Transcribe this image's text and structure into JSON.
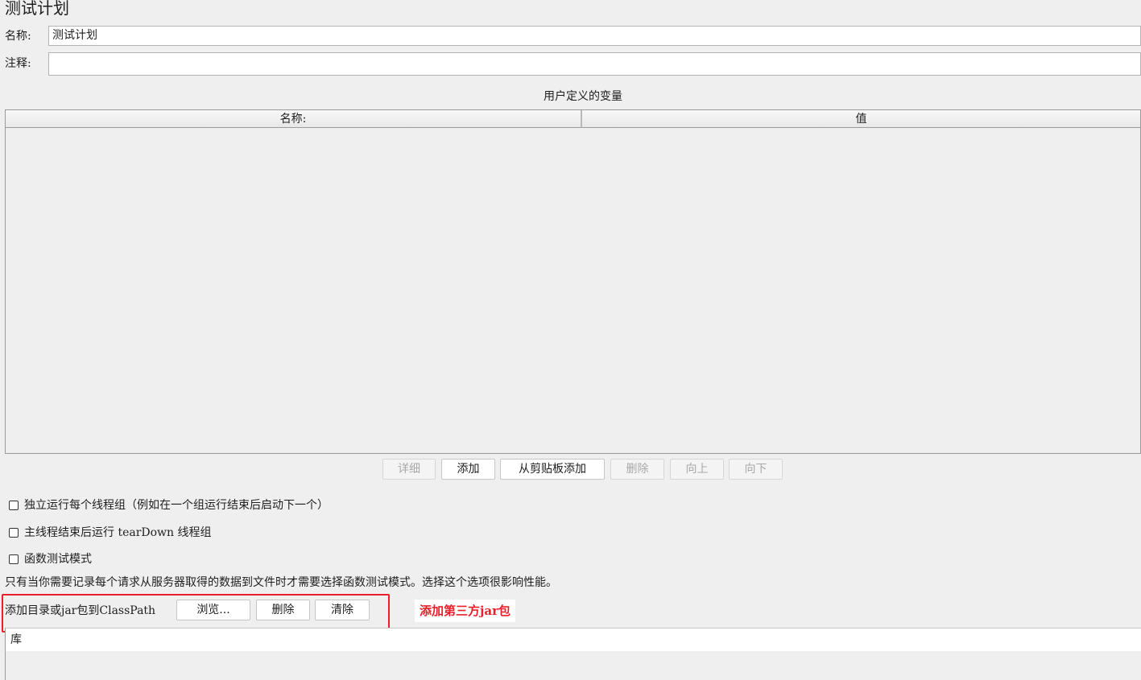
{
  "page_title": "测试计划",
  "name_field": {
    "label": "名称:",
    "value": "测试计划"
  },
  "comment_field": {
    "label": "注释:",
    "value": ""
  },
  "variables": {
    "section_title": "用户定义的变量",
    "columns": [
      "名称:",
      "值"
    ],
    "rows": []
  },
  "table_buttons": {
    "detail": "详细",
    "add": "添加",
    "add_from_clipboard": "从剪贴板添加",
    "delete": "删除",
    "up": "向上",
    "down": "向下"
  },
  "options": {
    "run_thread_groups_independently": {
      "label": "独立运行每个线程组（例如在一个组运行结束后启动下一个）",
      "checked": false
    },
    "run_teardown": {
      "label": "主线程结束后运行 tearDown 线程组",
      "checked": false
    },
    "functional_test_mode": {
      "label": "函数测试模式",
      "checked": false
    }
  },
  "functional_mode_note": "只有当你需要记录每个请求从服务器取得的数据到文件时才需要选择函数测试模式。选择这个选项很影响性能。",
  "classpath": {
    "label": "添加目录或jar包到ClassPath",
    "browse": "浏览...",
    "delete": "删除",
    "clear": "清除",
    "library_header": "库"
  },
  "annotation": {
    "text": "添加第三方jar包",
    "color": "#e8202a"
  }
}
